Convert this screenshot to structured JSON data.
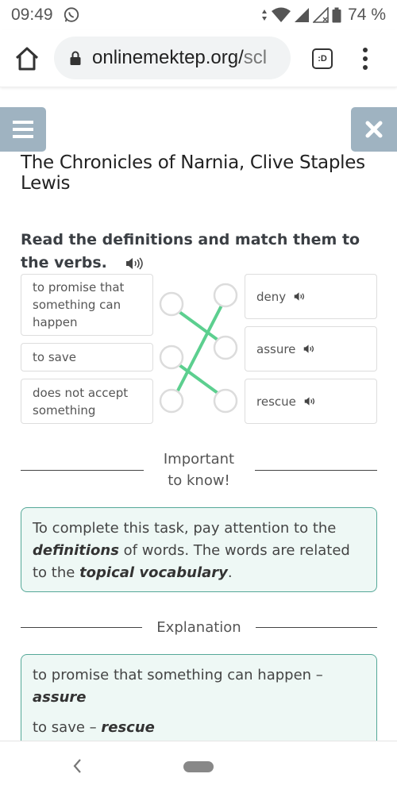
{
  "status_bar": {
    "time": "09:49",
    "battery": "74 %"
  },
  "browser": {
    "url_main": "onlinemektep.org/",
    "url_faded": "scl",
    "tab_label": ":D"
  },
  "page": {
    "title": "The Chronicles of Narnia, Clive Staples Lewis",
    "task_title": "Read the definitions and match them to the verbs."
  },
  "match": {
    "definitions": [
      "to promise that something can happen",
      "to save",
      "does not accept something"
    ],
    "verbs": [
      "deny",
      "assure",
      "rescue"
    ],
    "connections": [
      {
        "definition": 0,
        "verb": 1
      },
      {
        "definition": 1,
        "verb": 2
      },
      {
        "definition": 2,
        "verb": 0
      }
    ],
    "line_color": "#5ccf8f"
  },
  "important": {
    "heading": "Important to know!",
    "text_1": "To complete this task, pay attention to the ",
    "bold_1": "definitions",
    "text_2": " of words. The words are related to the ",
    "bold_2": "topical vocabulary",
    "text_3": "."
  },
  "explanation": {
    "heading": "Explanation",
    "items": [
      {
        "definition": "to promise that something can happen – ",
        "verb": "assure"
      },
      {
        "definition": "to save – ",
        "verb": "rescue"
      }
    ]
  },
  "colors": {
    "nav_button": "#9fb3c1",
    "note_bg": "#eef8f5",
    "note_border": "#55a898"
  }
}
